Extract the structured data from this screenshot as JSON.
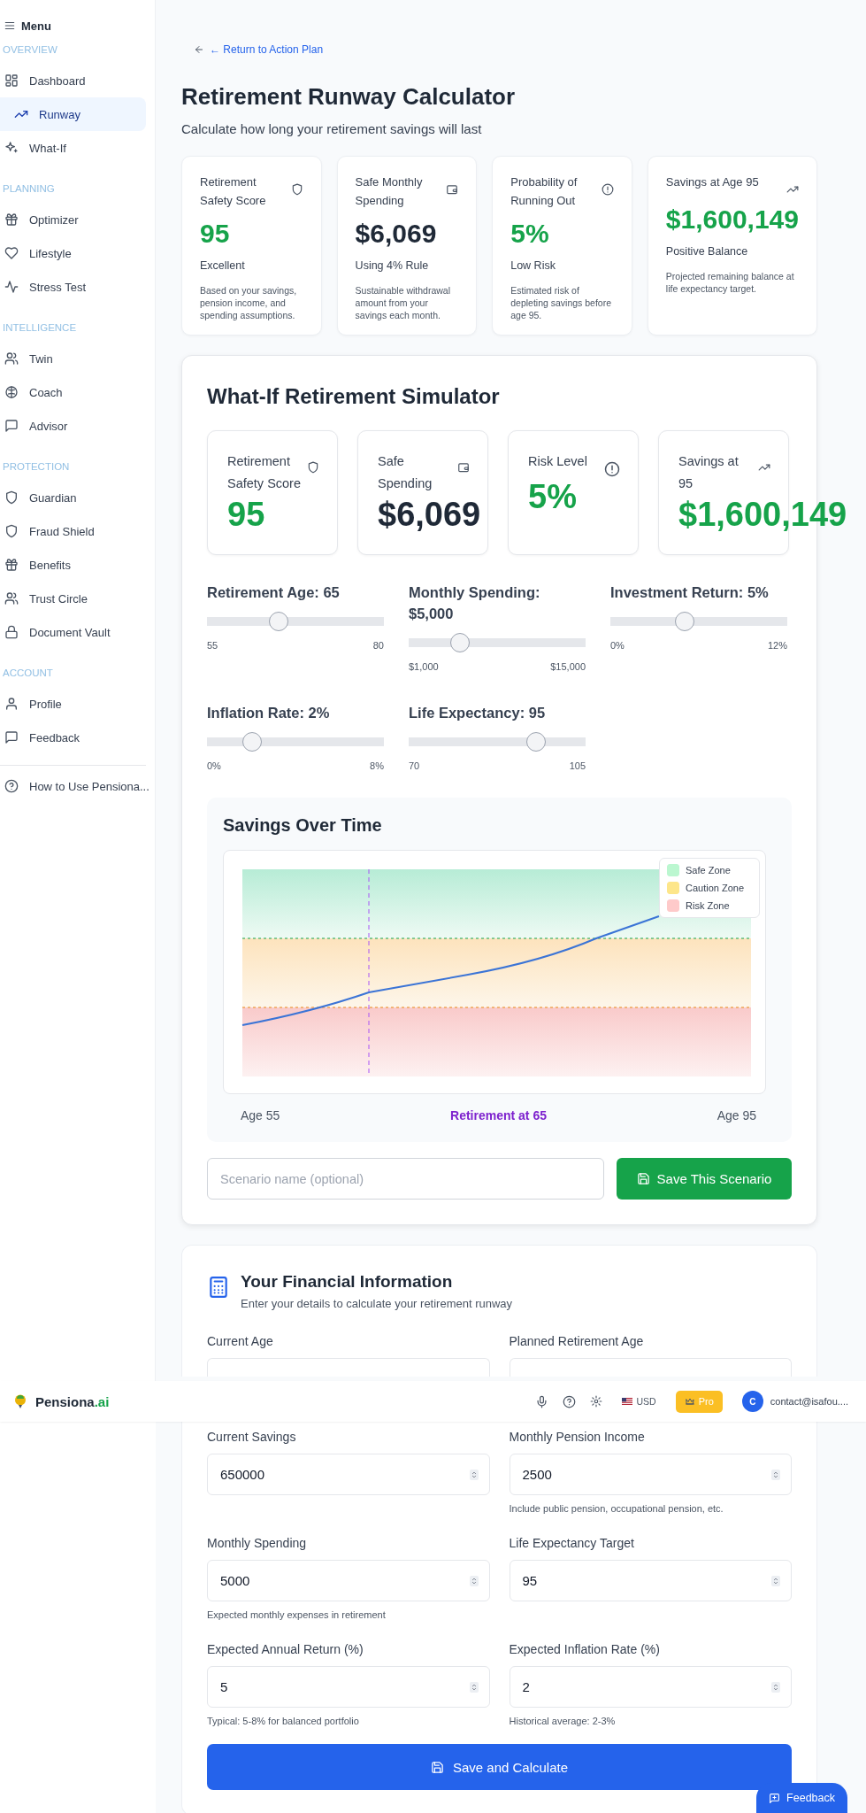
{
  "sidebar": {
    "menu_label": "Menu",
    "sections": [
      {
        "heading": "OVERVIEW",
        "items": [
          {
            "label": "Dashboard",
            "selected": false
          },
          {
            "label": "Runway",
            "selected": true
          },
          {
            "label": "What-If",
            "selected": false
          }
        ]
      },
      {
        "heading": "PLANNING",
        "items": [
          {
            "label": "Optimizer",
            "selected": false
          },
          {
            "label": "Lifestyle",
            "selected": false
          },
          {
            "label": "Stress Test",
            "selected": false
          }
        ]
      },
      {
        "heading": "INTELLIGENCE",
        "items": [
          {
            "label": "Twin",
            "selected": false
          },
          {
            "label": "Coach",
            "selected": false
          },
          {
            "label": "Advisor",
            "selected": false
          }
        ]
      },
      {
        "heading": "PROTECTION",
        "items": [
          {
            "label": "Guardian",
            "selected": false
          },
          {
            "label": "Fraud Shield",
            "selected": false
          },
          {
            "label": "Benefits",
            "selected": false
          },
          {
            "label": "Trust Circle",
            "selected": false
          },
          {
            "label": "Document Vault",
            "selected": false
          }
        ]
      },
      {
        "heading": "ACCOUNT",
        "items": [
          {
            "label": "Profile",
            "selected": false
          },
          {
            "label": "Feedback",
            "selected": false
          }
        ]
      }
    ],
    "help_link": "How to Use Pensiona..."
  },
  "back_link": "← Return to Action Plan",
  "title": "Retirement Runway Calculator",
  "subtitle": "Calculate how long your retirement savings will last",
  "summary_cards": [
    {
      "title": "Retirement Safety Score",
      "value": "95",
      "color": "#16a34a",
      "status": "Excellent",
      "description": "Based on your savings, pension income, and spending assumptions."
    },
    {
      "title": "Safe Monthly Spending",
      "value": "$6,069",
      "color": "#1f2937",
      "status": "Using 4% Rule",
      "description": "Sustainable withdrawal amount from your savings each month."
    },
    {
      "title": "Probability of Running Out",
      "value": "5%",
      "color": "#16a34a",
      "status": "Low Risk",
      "description": "Estimated risk of depleting savings before age 95."
    },
    {
      "title": "Savings at Age 95",
      "value": "$1,600,149",
      "color": "#16a34a",
      "status": "Positive Balance",
      "description": "Projected remaining balance at life expectancy target."
    }
  ],
  "simulator": {
    "title": "What-If Retirement Simulator",
    "cards": [
      {
        "title": "Retirement Safety Score",
        "value": "95",
        "color": "#16a34a"
      },
      {
        "title": "Safe Spending",
        "value": "$6,069",
        "color": "#1f2937"
      },
      {
        "title": "Risk Level",
        "value": "5%",
        "color": "#16a34a"
      },
      {
        "title": "Savings at 95",
        "value": "$1,600,149",
        "color": "#16a34a"
      }
    ],
    "sliders": [
      {
        "label": "Retirement Age: 65",
        "min_label": "55",
        "max_label": "80",
        "level": 0.4
      },
      {
        "label": "Monthly Spending: $5,000",
        "min_label": "$1,000",
        "max_label": "$15,000",
        "level": 0.286
      },
      {
        "label": "Investment Return: 5%",
        "min_label": "0%",
        "max_label": "12%",
        "level": 0.417
      },
      {
        "label": "Inflation Rate: 2%",
        "min_label": "0%",
        "max_label": "8%",
        "level": 0.25
      },
      {
        "label": "Life Expectancy: 95",
        "min_label": "70",
        "max_label": "105",
        "level": 0.714
      }
    ],
    "chart_panel": {
      "title": "Savings Over Time",
      "legend": [
        {
          "label": "Safe Zone",
          "color": "#bbf7d0"
        },
        {
          "label": "Caution Zone",
          "color": "#fde68a"
        },
        {
          "label": "Risk Zone",
          "color": "#fecaca"
        }
      ],
      "axis_start": "Age 55",
      "retirement_label": "Retirement at 65",
      "axis_end": "Age 95"
    },
    "scenario_input": {
      "placeholder": "Scenario name (optional)"
    },
    "save_button": "Save This Scenario"
  },
  "financial_form": {
    "title": "Your Financial Information",
    "subtitle": "Enter your details to calculate your retirement runway",
    "fields": [
      {
        "label": "Current Age"
      },
      {
        "label": "Planned Retirement Age"
      },
      {
        "label": "Current Savings",
        "value": "650000"
      },
      {
        "label": "Monthly Pension Income",
        "value": "2500",
        "hint": "Include public pension, occupational pension, etc."
      },
      {
        "label": "Monthly Spending",
        "value": "5000",
        "hint": "Expected monthly expenses in retirement"
      },
      {
        "label": "Life Expectancy Target",
        "value": "95"
      },
      {
        "label": "Expected Annual Return (%)",
        "value": "5",
        "hint": "Typical: 5-8% for balanced portfolio"
      },
      {
        "label": "Expected Inflation Rate (%)",
        "value": "2",
        "hint": "Historical average: 2-3%"
      }
    ],
    "submit_button": "Save and Calculate"
  },
  "header": {
    "logo_name": "Pensiona",
    "logo_suffix": ".ai",
    "currency": "USD",
    "plan_badge": "Pro",
    "avatar_initial": "C",
    "account_email": "contact@isafou...."
  },
  "feedback_button": "Feedback"
}
